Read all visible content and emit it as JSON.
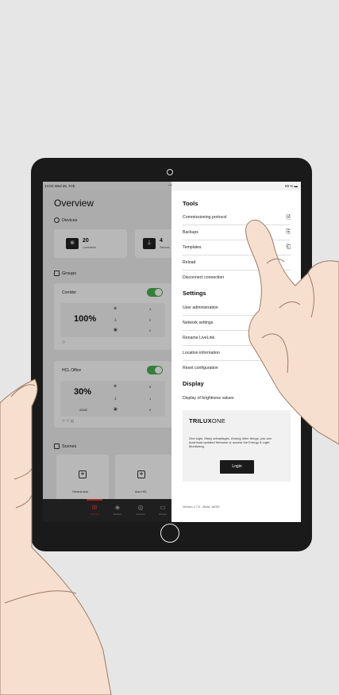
{
  "status_bar": {
    "time": "14:02  Wed 26. Feb",
    "battery": "89 %"
  },
  "overview": {
    "title": "Overview",
    "devices_label": "Devices",
    "devices": [
      {
        "count": "20",
        "label": "Luminaires",
        "icon": "luminaire-icon"
      },
      {
        "count": "4",
        "label": "Sensors",
        "icon": "sensor-icon"
      }
    ],
    "groups_label": "Groups",
    "groups": [
      {
        "name": "Corridor",
        "level": "100%",
        "on": true,
        "counts": [
          "4",
          "2",
          "0"
        ]
      },
      {
        "name": "HCL Office",
        "level": "30%",
        "cct": "4000K",
        "on": true,
        "counts": [
          "8",
          "1",
          "0"
        ]
      }
    ],
    "scenes_label": "Scenes",
    "scenes": [
      {
        "label": "General auto",
        "icon": "scene-icon"
      },
      {
        "label": "Auto HCL",
        "icon": "scene-icon"
      }
    ],
    "tabs": [
      {
        "label": "Overview",
        "icon": "overview-icon",
        "active": true
      },
      {
        "label": "Devices",
        "icon": "devices-icon",
        "active": false
      },
      {
        "label": "Sensors",
        "icon": "sensors-icon",
        "active": false
      },
      {
        "label": "Groups",
        "icon": "groups-icon",
        "active": false
      }
    ]
  },
  "menu": {
    "tools_heading": "Tools",
    "tools": [
      {
        "label": "Commissioning protocol",
        "icon": "document-icon"
      },
      {
        "label": "Backups",
        "icon": "backup-icon"
      },
      {
        "label": "Templates",
        "icon": "template-icon"
      },
      {
        "label": "Reload",
        "icon": ""
      },
      {
        "label": "Disconnect connection",
        "icon": ""
      }
    ],
    "settings_heading": "Settings",
    "settings": [
      {
        "label": "User administration"
      },
      {
        "label": "Network settings"
      },
      {
        "label": "Rename LiveLink"
      },
      {
        "label": "Location information"
      },
      {
        "label": "Reset configuration"
      }
    ],
    "display_heading": "Display",
    "display": [
      {
        "label": "Display of brightness values"
      }
    ],
    "promo": {
      "brand_bold": "TRILUX",
      "brand_light": "ONE",
      "text": "One login. Many advantages. Among other things, you can download updated firmware or access the Energy & Light Monitoring.",
      "login_label": "Login"
    },
    "version": "Version 1.7.0 - Build: 16032"
  },
  "colors": {
    "accent": "#e53935",
    "toggle_on": "#4caf50",
    "button": "#1a1a1a"
  }
}
